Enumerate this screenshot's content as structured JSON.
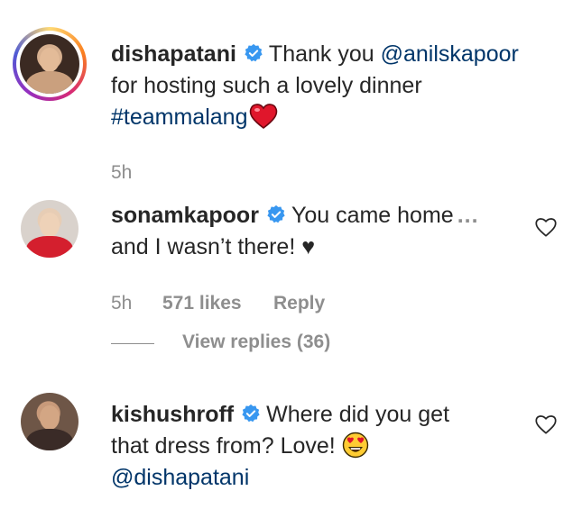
{
  "comments": [
    {
      "username": "dishapatani",
      "line1_text": "Thank you ",
      "mention": "@anilskapoor",
      "line2": "for hosting such a lovely dinner",
      "hashtag": "#teammalang",
      "time": "5h",
      "avatar_icon": "avatar-dishapatani"
    },
    {
      "username": "sonamkapoor",
      "line1_text": "You came home",
      "more": "...",
      "line2": "and I wasn’t there! ♥",
      "time": "5h",
      "likes": "571 likes",
      "reply": "Reply",
      "view_replies": "View replies (36)",
      "avatar_icon": "avatar-sonamkapoor"
    },
    {
      "username": "kishushroff",
      "line1_text": "Where did you get",
      "line2": "that dress from? Love! ",
      "mention": "@dishapatani",
      "avatar_icon": "avatar-kishushroff"
    }
  ],
  "colors": {
    "verified": "#3897f0",
    "link": "#003569",
    "meta": "#8e8e8e",
    "heart_emoji": "#e0162b"
  },
  "icons": {
    "verified": "verified-badge-icon",
    "like": "heart-outline-icon",
    "heart_emoji": "red-heart-emoji",
    "heart_eyes": "heart-eyes-emoji",
    "more": "ellipsis-icon"
  }
}
